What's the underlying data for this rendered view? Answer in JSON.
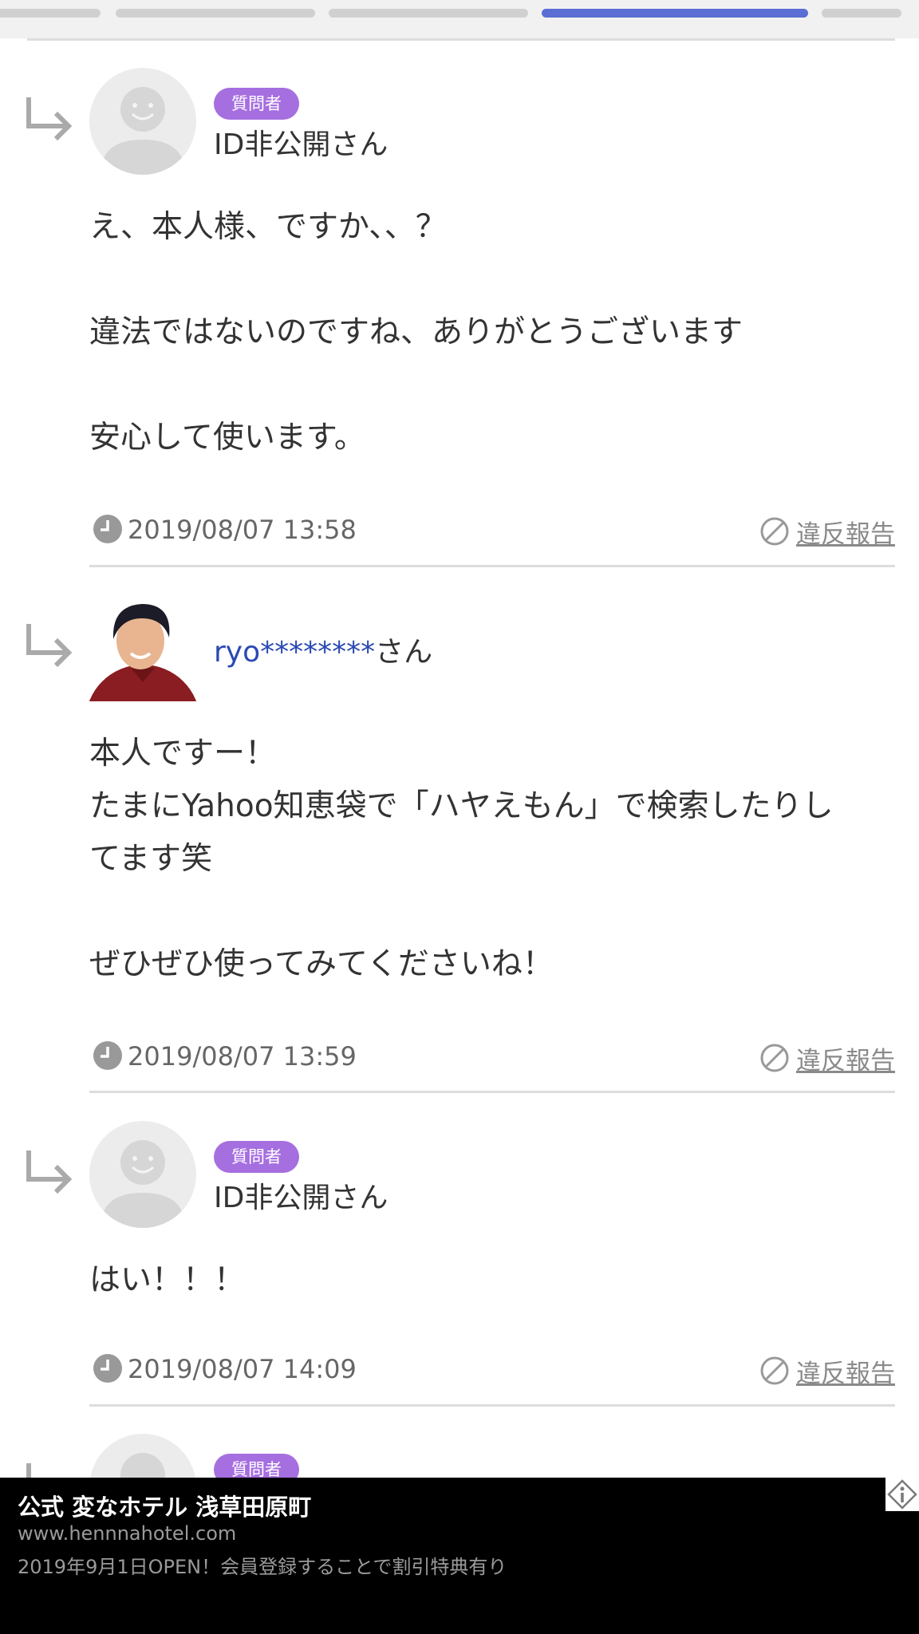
{
  "progress": {
    "segments": 5,
    "active_index": 3
  },
  "comments": [
    {
      "role_badge": "質問者",
      "name": "ID非公開さん",
      "lines": [
        "え、本人様、ですか、、？",
        "",
        "違法ではないのですね、ありがとうございます",
        "",
        "安心して使います。"
      ],
      "timestamp": "2019/08/07 13:58",
      "report_label": "違反報告"
    },
    {
      "name_id": "ryo********",
      "name_suffix": "さん",
      "lines": [
        "本人ですー！",
        "たまにYahoo知恵袋で「ハヤえもん」で検索したりし",
        "てます笑",
        "",
        "ぜひぜひ使ってみてくださいね！"
      ],
      "timestamp": "2019/08/07 13:59",
      "report_label": "違反報告"
    },
    {
      "role_badge": "質問者",
      "name": "ID非公開さん",
      "lines": [
        "はい！！！"
      ],
      "timestamp": "2019/08/07 14:09",
      "report_label": "違反報告"
    },
    {
      "role_badge": "質問者"
    }
  ],
  "ad": {
    "title": "公式 変なホテル 浅草田原町",
    "url": "www.hennnahotel.com",
    "description": "2019年9月1日OPEN！会員登録することで割引特典有り"
  },
  "icons": [
    "reply-arrow-icon",
    "clock-icon",
    "prohibited-icon",
    "ad-info-icon"
  ],
  "colors": {
    "accent": "#5b6ed3",
    "badge": "#a66fe0",
    "link_blue": "#2b49b4"
  }
}
